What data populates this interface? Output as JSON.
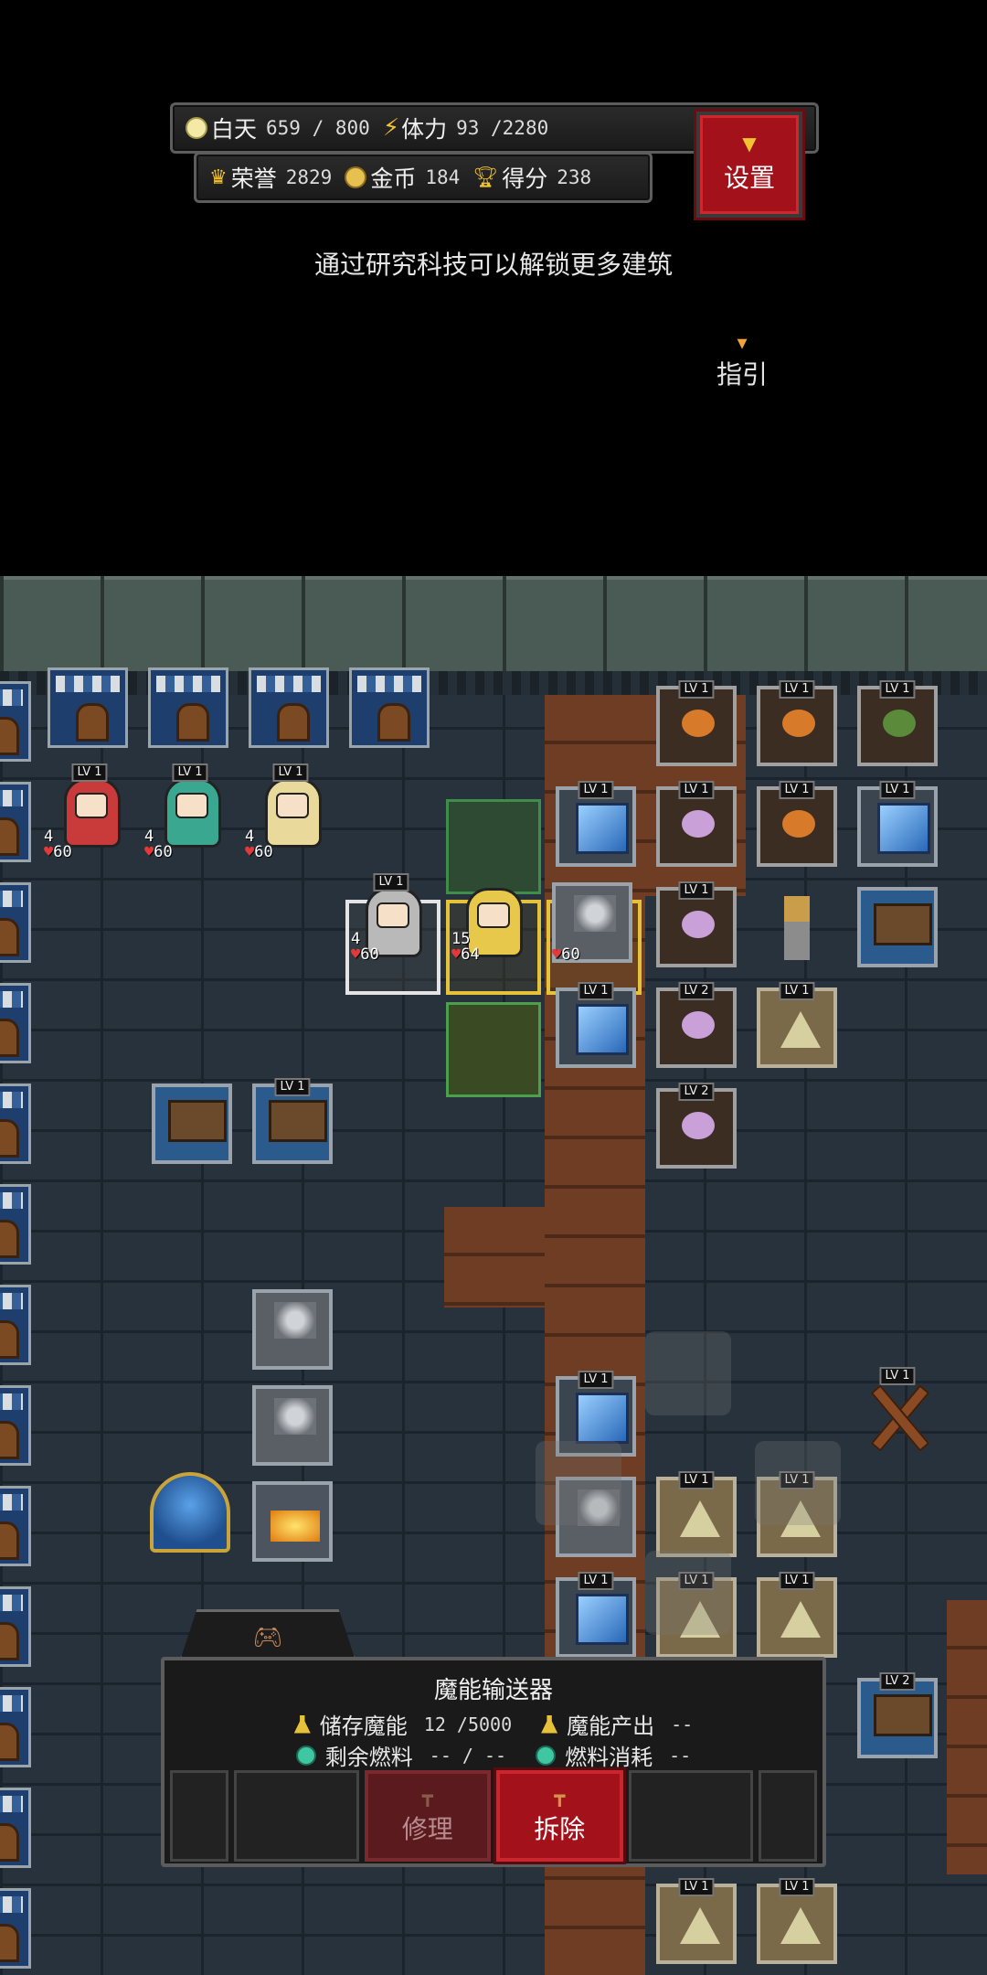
{
  "hud": {
    "day_label": "白天",
    "day_value": "659 / 800",
    "stamina_label": "体力",
    "stamina_value": "93 /2280",
    "honor_label": "荣誉",
    "honor_value": "2829",
    "gold_label": "金币",
    "gold_value": "184",
    "score_label": "得分",
    "score_value": "238",
    "settings_label": "设置"
  },
  "hint": "通过研究科技可以解锁更多建筑",
  "guide_label": "指引",
  "board": {
    "level_tags": {
      "lv1": "LV 1",
      "lv2": "LV 2"
    },
    "units": [
      {
        "name": "red-hood-girl",
        "atk": "4",
        "hp": "60",
        "color": "#c93a3a"
      },
      {
        "name": "green-hair-girl",
        "atk": "4",
        "hp": "60",
        "color": "#3aa890"
      },
      {
        "name": "angel-girl",
        "atk": "4",
        "hp": "60",
        "color": "#e9d99a"
      },
      {
        "name": "white-hair-warrior",
        "atk": "4",
        "hp": "60",
        "color": "#b9b9b9"
      },
      {
        "name": "blonde-mage",
        "atk": "15",
        "hp": "64",
        "color": "#e8c84a"
      },
      {
        "name": "mana-transmitter",
        "atk": "",
        "hp": "60",
        "color": "#8f8f8f"
      }
    ]
  },
  "panel": {
    "title": "魔能输送器",
    "stored_label": "储存魔能",
    "stored_value": "12 /5000",
    "output_label": "魔能产出",
    "output_value": "--",
    "fuel_label": "剩余燃料",
    "fuel_value": "-- / --",
    "consume_label": "燃料消耗",
    "consume_value": "--",
    "repair_label": "修理",
    "remove_label": "拆除"
  },
  "colors": {
    "accent_red": "#a3121a",
    "gold": "#f2c230",
    "board_bg": "#27323d"
  }
}
